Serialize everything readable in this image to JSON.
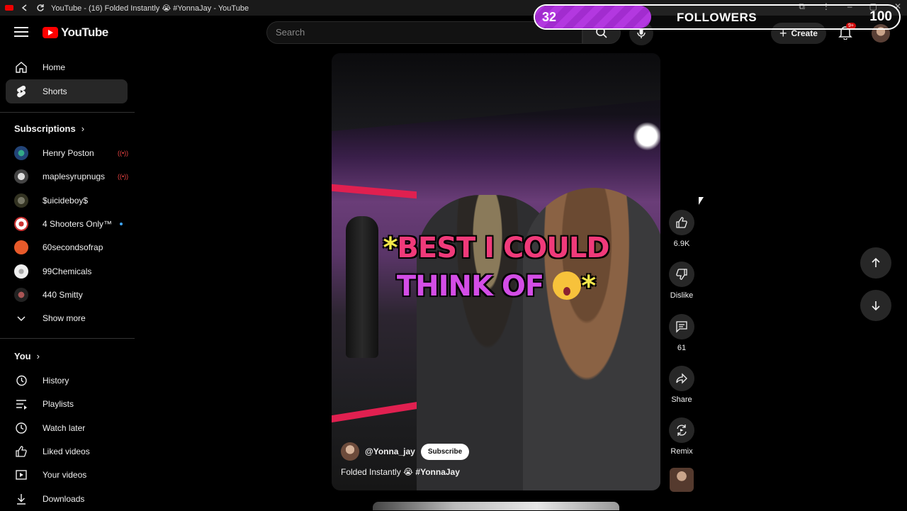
{
  "window": {
    "title": "YouTube - (16) Folded Instantly 😭 #YonnaJay - YouTube"
  },
  "followers_overlay": {
    "current": "32",
    "label": "FOLLOWERS",
    "goal": "100",
    "progress_fraction": 0.32,
    "bar_color": "#b338e0"
  },
  "header": {
    "logo_text": "YouTube",
    "search_placeholder": "Search",
    "create_label": "Create",
    "notification_badge": "9+",
    "icons": [
      "menu-icon",
      "search-icon",
      "mic-icon",
      "plus-icon",
      "bell-icon"
    ]
  },
  "sidebar": {
    "main": [
      {
        "label": "Home",
        "icon": "home-icon"
      },
      {
        "label": "Shorts",
        "icon": "shorts-icon",
        "active": true
      }
    ],
    "subscriptions_title": "Subscriptions",
    "subscriptions": [
      {
        "label": "Henry Poston",
        "status": "live"
      },
      {
        "label": "maplesyrupnugs",
        "status": "live"
      },
      {
        "label": "$uicideboy$",
        "status": ""
      },
      {
        "label": "4 Shooters Only™",
        "status": "new"
      },
      {
        "label": "60secondsofrap",
        "status": ""
      },
      {
        "label": "99Chemicals",
        "status": ""
      },
      {
        "label": "440 Smitty",
        "status": ""
      }
    ],
    "show_more": "Show more",
    "you_title": "You",
    "you_items": [
      {
        "label": "History",
        "icon": "history-icon"
      },
      {
        "label": "Playlists",
        "icon": "playlist-icon"
      },
      {
        "label": "Watch later",
        "icon": "clock-icon"
      },
      {
        "label": "Liked videos",
        "icon": "thumb-up-icon"
      },
      {
        "label": "Your videos",
        "icon": "video-icon"
      },
      {
        "label": "Downloads",
        "icon": "download-icon"
      }
    ]
  },
  "short": {
    "overlay_line1_a": "*",
    "overlay_line1_b": "BEST I COULD",
    "overlay_line2_a": "THINK OF",
    "overlay_line2_b": "*",
    "channel": "@Yonna_jay",
    "subscribe": "Subscribe",
    "caption_text": "Folded Instantly 😭",
    "caption_tag": "#YonnaJay"
  },
  "actions": {
    "like_count": "6.9K",
    "dislike_label": "Dislike",
    "comment_count": "61",
    "share_label": "Share",
    "remix_label": "Remix"
  }
}
